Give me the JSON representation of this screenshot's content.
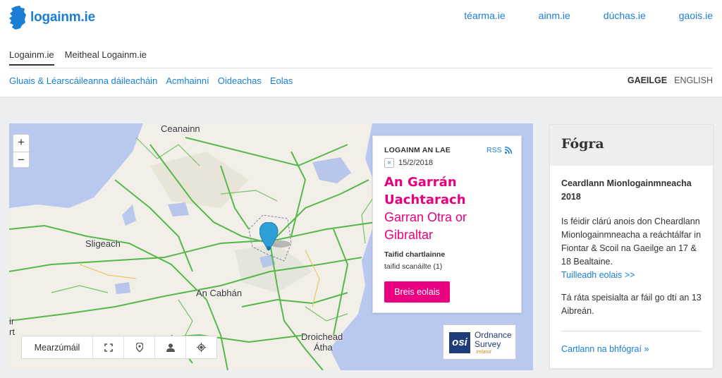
{
  "header": {
    "brand": "logainm.ie",
    "external_links": [
      "téarma.ie",
      "ainm.ie",
      "dúchas.ie",
      "gaois.ie"
    ]
  },
  "tabs": [
    {
      "label": "Logainm.ie",
      "active": true
    },
    {
      "label": "Meitheal Logainm.ie",
      "active": false
    }
  ],
  "subnav": [
    "Gluais & Léarscáileanna dáileacháin",
    "Acmhainní",
    "Oideachas",
    "Eolas"
  ],
  "languages": {
    "current": "GAEILGE",
    "other": "ENGLISH"
  },
  "map": {
    "zoom_in": "+",
    "zoom_out": "−",
    "places": [
      "Ceanainn",
      "Sligeach",
      "An Cabhán",
      "Droichead",
      "Átha"
    ],
    "edge_labels": [
      "ir",
      "rt"
    ],
    "toolbar_first": "Mearzúmáil",
    "toolbar_icons": [
      "fullscreen-icon",
      "pin-icon",
      "person-icon",
      "locate-icon"
    ],
    "attribution": {
      "line1": "Ordnance",
      "line2": "Survey",
      "sub": "Ireland",
      "badge": "osi"
    },
    "colors": {
      "roads": "#55b84a",
      "sea": "#b8c8ef",
      "lakes": "#b7c6ea",
      "marker": "#2f9fd8"
    }
  },
  "place_of_day": {
    "kicker": "LOGAINM AN LAE",
    "rss": "RSS",
    "prev": "«",
    "date": "15/2/2018",
    "name_ga": "An Garrán Uachtarach",
    "name_en": "Garran Otra or Gibraltar",
    "archive_label": "Taifid chartlainne",
    "scanned": "taifid scanáilte (1)",
    "button": "Breis eolais",
    "accent": "#e6007e"
  },
  "notice": {
    "heading": "Fógra",
    "title": "Ceardlann Mionlogainmneacha 2018",
    "text1": "Is féidir clárú anois don Cheardlann Mionlogainmneacha a reáchtálfar in Fiontar & Scoil na Gaeilge an 17 & 18 Bealtaine.",
    "more": "Tuilleadh eolais >>",
    "text2": "Tá ráta speisialta ar fáil go dtí an 13 Aibreán.",
    "archive": "Cartlann na bhfógraí »"
  }
}
